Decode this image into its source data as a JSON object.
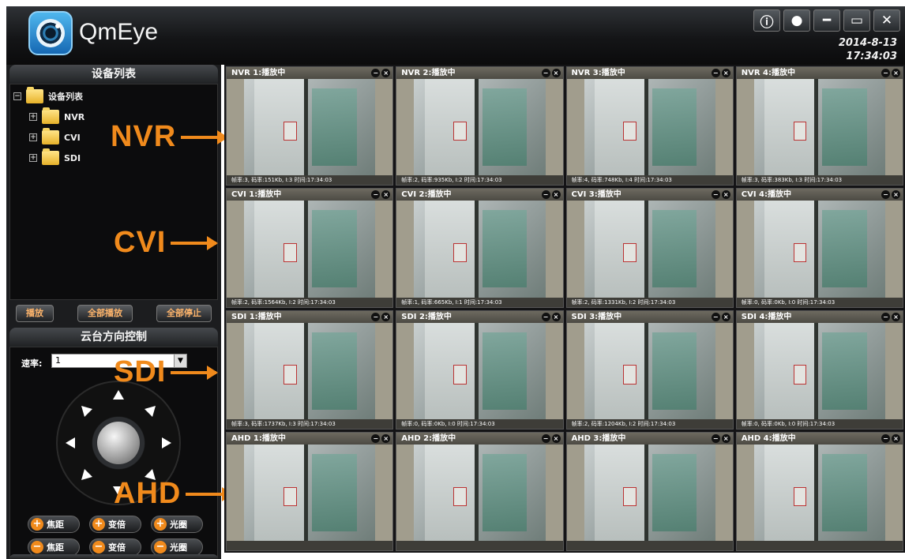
{
  "app": {
    "name": "QmEye",
    "date": "2014-8-13",
    "time": "17:34:03"
  },
  "window_buttons": [
    {
      "name": "info-button",
      "glyph": "ⓘ"
    },
    {
      "name": "user-button",
      "glyph": "●"
    },
    {
      "name": "minimize-button",
      "glyph": "━"
    },
    {
      "name": "restore-button",
      "glyph": "▭"
    },
    {
      "name": "close-button",
      "glyph": "✕"
    }
  ],
  "device_panel": {
    "title": "设备列表",
    "root": "设备列表",
    "children": [
      "NVR",
      "CVI",
      "SDI"
    ]
  },
  "annotations": [
    "NVR",
    "CVI",
    "SDI",
    "AHD"
  ],
  "playback_buttons": [
    "播放",
    "全部播放",
    "全部停止"
  ],
  "ptz": {
    "title": "云台方向控制",
    "speed_label": "速率:",
    "speed_value": "1",
    "plus_buttons": [
      "焦距",
      "变倍",
      "光圈"
    ],
    "minus_buttons": [
      "焦距",
      "变倍",
      "光圈"
    ]
  },
  "colors": {
    "accent": "#f08a1c",
    "titlebar": "#141517",
    "panel": "#1c1d1f"
  },
  "channels": [
    {
      "title": "NVR 1:播放中",
      "status": "帧率:3, 码率:151Kb, I:3    时间:17:34:03"
    },
    {
      "title": "NVR 2:播放中",
      "status": "帧率:2, 码率:935Kb, I:2    时间:17:34:03"
    },
    {
      "title": "NVR 3:播放中",
      "status": "帧率:4, 码率:748Kb, I:4    时间:17:34:03"
    },
    {
      "title": "NVR 4:播放中",
      "status": "帧率:3, 码率:383Kb, I:3    时间:17:34:03"
    },
    {
      "title": "CVI 1:播放中",
      "status": "帧率:2, 码率:1564Kb, I:2    时间:17:34:03"
    },
    {
      "title": "CVI 2:播放中",
      "status": "帧率:1, 码率:665Kb, I:1    时间:17:34:03"
    },
    {
      "title": "CVI 3:播放中",
      "status": "帧率:2, 码率:1331Kb, I:2    时间:17:34:03"
    },
    {
      "title": "CVI 4:播放中",
      "status": "帧率:0, 码率:0Kb, I:0    时间:17:34:03"
    },
    {
      "title": "SDI 1:播放中",
      "status": "帧率:3, 码率:1737Kb, I:3    时间:17:34:03"
    },
    {
      "title": "SDI 2:播放中",
      "status": "帧率:0, 码率:0Kb, I:0    时间:17:34:03"
    },
    {
      "title": "SDI 3:播放中",
      "status": "帧率:2, 码率:1204Kb, I:2    时间:17:34:03"
    },
    {
      "title": "SDI 4:播放中",
      "status": "帧率:0, 码率:0Kb, I:0    时间:17:34:03"
    },
    {
      "title": "AHD 1:播放中",
      "status": ""
    },
    {
      "title": "AHD 2:播放中",
      "status": ""
    },
    {
      "title": "AHD 3:播放中",
      "status": ""
    },
    {
      "title": "AHD 4:播放中",
      "status": ""
    }
  ]
}
